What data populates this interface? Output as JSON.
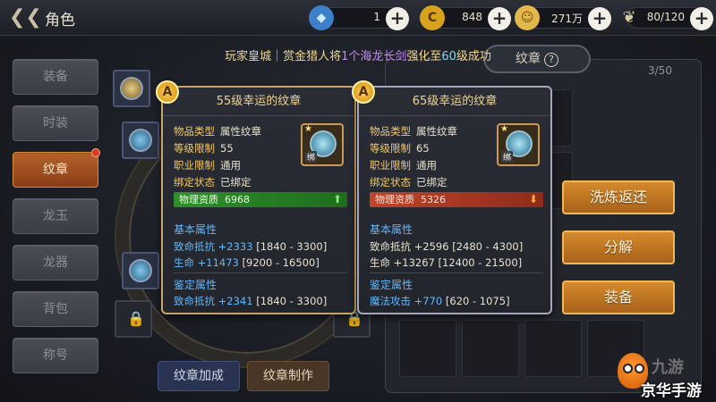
{
  "header": {
    "title": "角色",
    "resources": [
      {
        "name": "diamond",
        "icon": "blue-gem-icon",
        "value": "1"
      },
      {
        "name": "currency-c",
        "icon": "gold-c-coin-icon",
        "value": "848"
      },
      {
        "name": "gold",
        "icon": "gold-coin-icon",
        "value": "271万"
      },
      {
        "name": "stamina",
        "icon": "wing-icon",
        "value": "80/120"
      }
    ]
  },
  "broadcast": {
    "prefix": "玩家皇城｜赏金猎人将",
    "item": "1个海龙长剑",
    "mid": "强化至",
    "level": "60",
    "suffix": "级成功"
  },
  "nav": {
    "items": [
      {
        "label": "装备",
        "active": false
      },
      {
        "label": "时装",
        "active": false
      },
      {
        "label": "纹章",
        "active": true
      },
      {
        "label": "龙玉",
        "active": false
      },
      {
        "label": "龙器",
        "active": false
      },
      {
        "label": "背包",
        "active": false
      },
      {
        "label": "称号",
        "active": false
      }
    ]
  },
  "bottom_buttons": {
    "bonus": "纹章加成",
    "craft": "纹章制作"
  },
  "right_panel": {
    "tab_label": "纹章",
    "help": "?",
    "count": "3/50",
    "actions": [
      "洗炼返还",
      "分解",
      "装备"
    ]
  },
  "cards": [
    {
      "grade": "A",
      "title": "55级幸运的纹章",
      "props": [
        {
          "k": "物品类型",
          "v": "属性纹章"
        },
        {
          "k": "等级限制",
          "v": "55"
        },
        {
          "k": "职业限制",
          "v": "通用"
        },
        {
          "k": "绑定状态",
          "v": "已绑定"
        }
      ],
      "bind_tag": "绑",
      "aptitude": {
        "label": "物理资质",
        "value": "6968",
        "trend": "up"
      },
      "base_head": "基本属性",
      "base": [
        {
          "nm": "致命抵抗 +2333",
          "rg": "[1840 - 3300]"
        },
        {
          "nm": "生命 +11473",
          "rg": "[9200 - 16500]"
        }
      ],
      "ident_head": "鉴定属性",
      "ident": [
        {
          "nm": "致命抵抗 +2341",
          "rg": "[1840 - 3300]"
        }
      ]
    },
    {
      "grade": "A",
      "title": "65级幸运的纹章",
      "props": [
        {
          "k": "物品类型",
          "v": "属性纹章"
        },
        {
          "k": "等级限制",
          "v": "65"
        },
        {
          "k": "职业限制",
          "v": "通用"
        },
        {
          "k": "绑定状态",
          "v": "已绑定"
        }
      ],
      "bind_tag": "绑",
      "aptitude": {
        "label": "物理资质",
        "value": "5326",
        "trend": "down"
      },
      "base_head": "基本属性",
      "base": [
        {
          "nm": "致命抵抗 +2596",
          "rg": "[2480 - 4300]"
        },
        {
          "nm": "生命 +13267",
          "rg": "[12400 - 21500]"
        }
      ],
      "ident_head": "鉴定属性",
      "ident": [
        {
          "nm": "魔法攻击 +770",
          "rg": "[620 - 1075]"
        }
      ]
    }
  ],
  "watermark": {
    "big": "九游",
    "site": "京华手游"
  },
  "colors": {
    "accent_orange": "#d48a2c",
    "tooltip_gold": "#f0c96d",
    "stat_blue": "#5fb8ff",
    "aptitude_up": "#2e8f2a",
    "aptitude_down": "#c0442a"
  }
}
